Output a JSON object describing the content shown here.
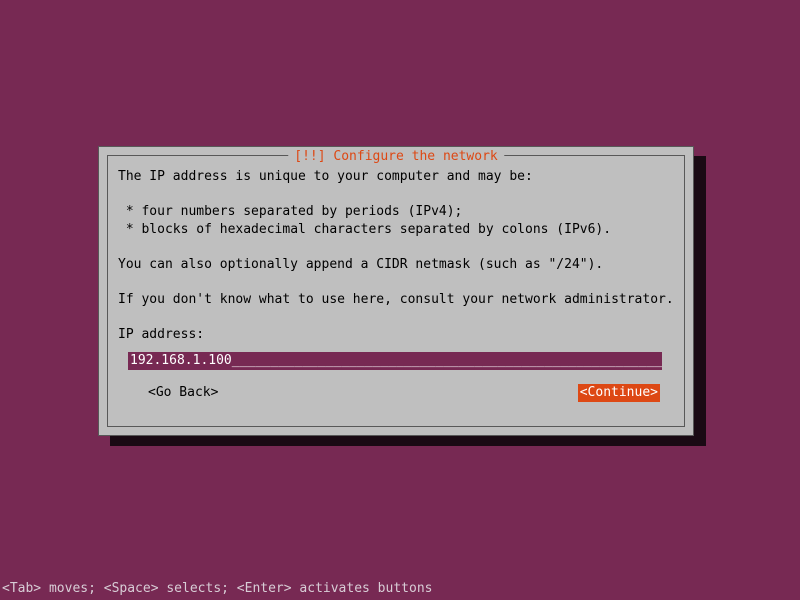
{
  "dialog": {
    "title": "[!!] Configure the network",
    "line1": "The IP address is unique to your computer and may be:",
    "bullet1": " * four numbers separated by periods (IPv4);",
    "bullet2": " * blocks of hexadecimal characters separated by colons (IPv6).",
    "line2": "You can also optionally append a CIDR netmask (such as \"/24\").",
    "line3": "If you don't know what to use here, consult your network administrator.",
    "field_label": "IP address:",
    "ip_value": "192.168.1.100",
    "go_back": "<Go Back>",
    "continue": "<Continue>"
  },
  "footer": {
    "hint": "<Tab> moves; <Space> selects; <Enter> activates buttons"
  }
}
